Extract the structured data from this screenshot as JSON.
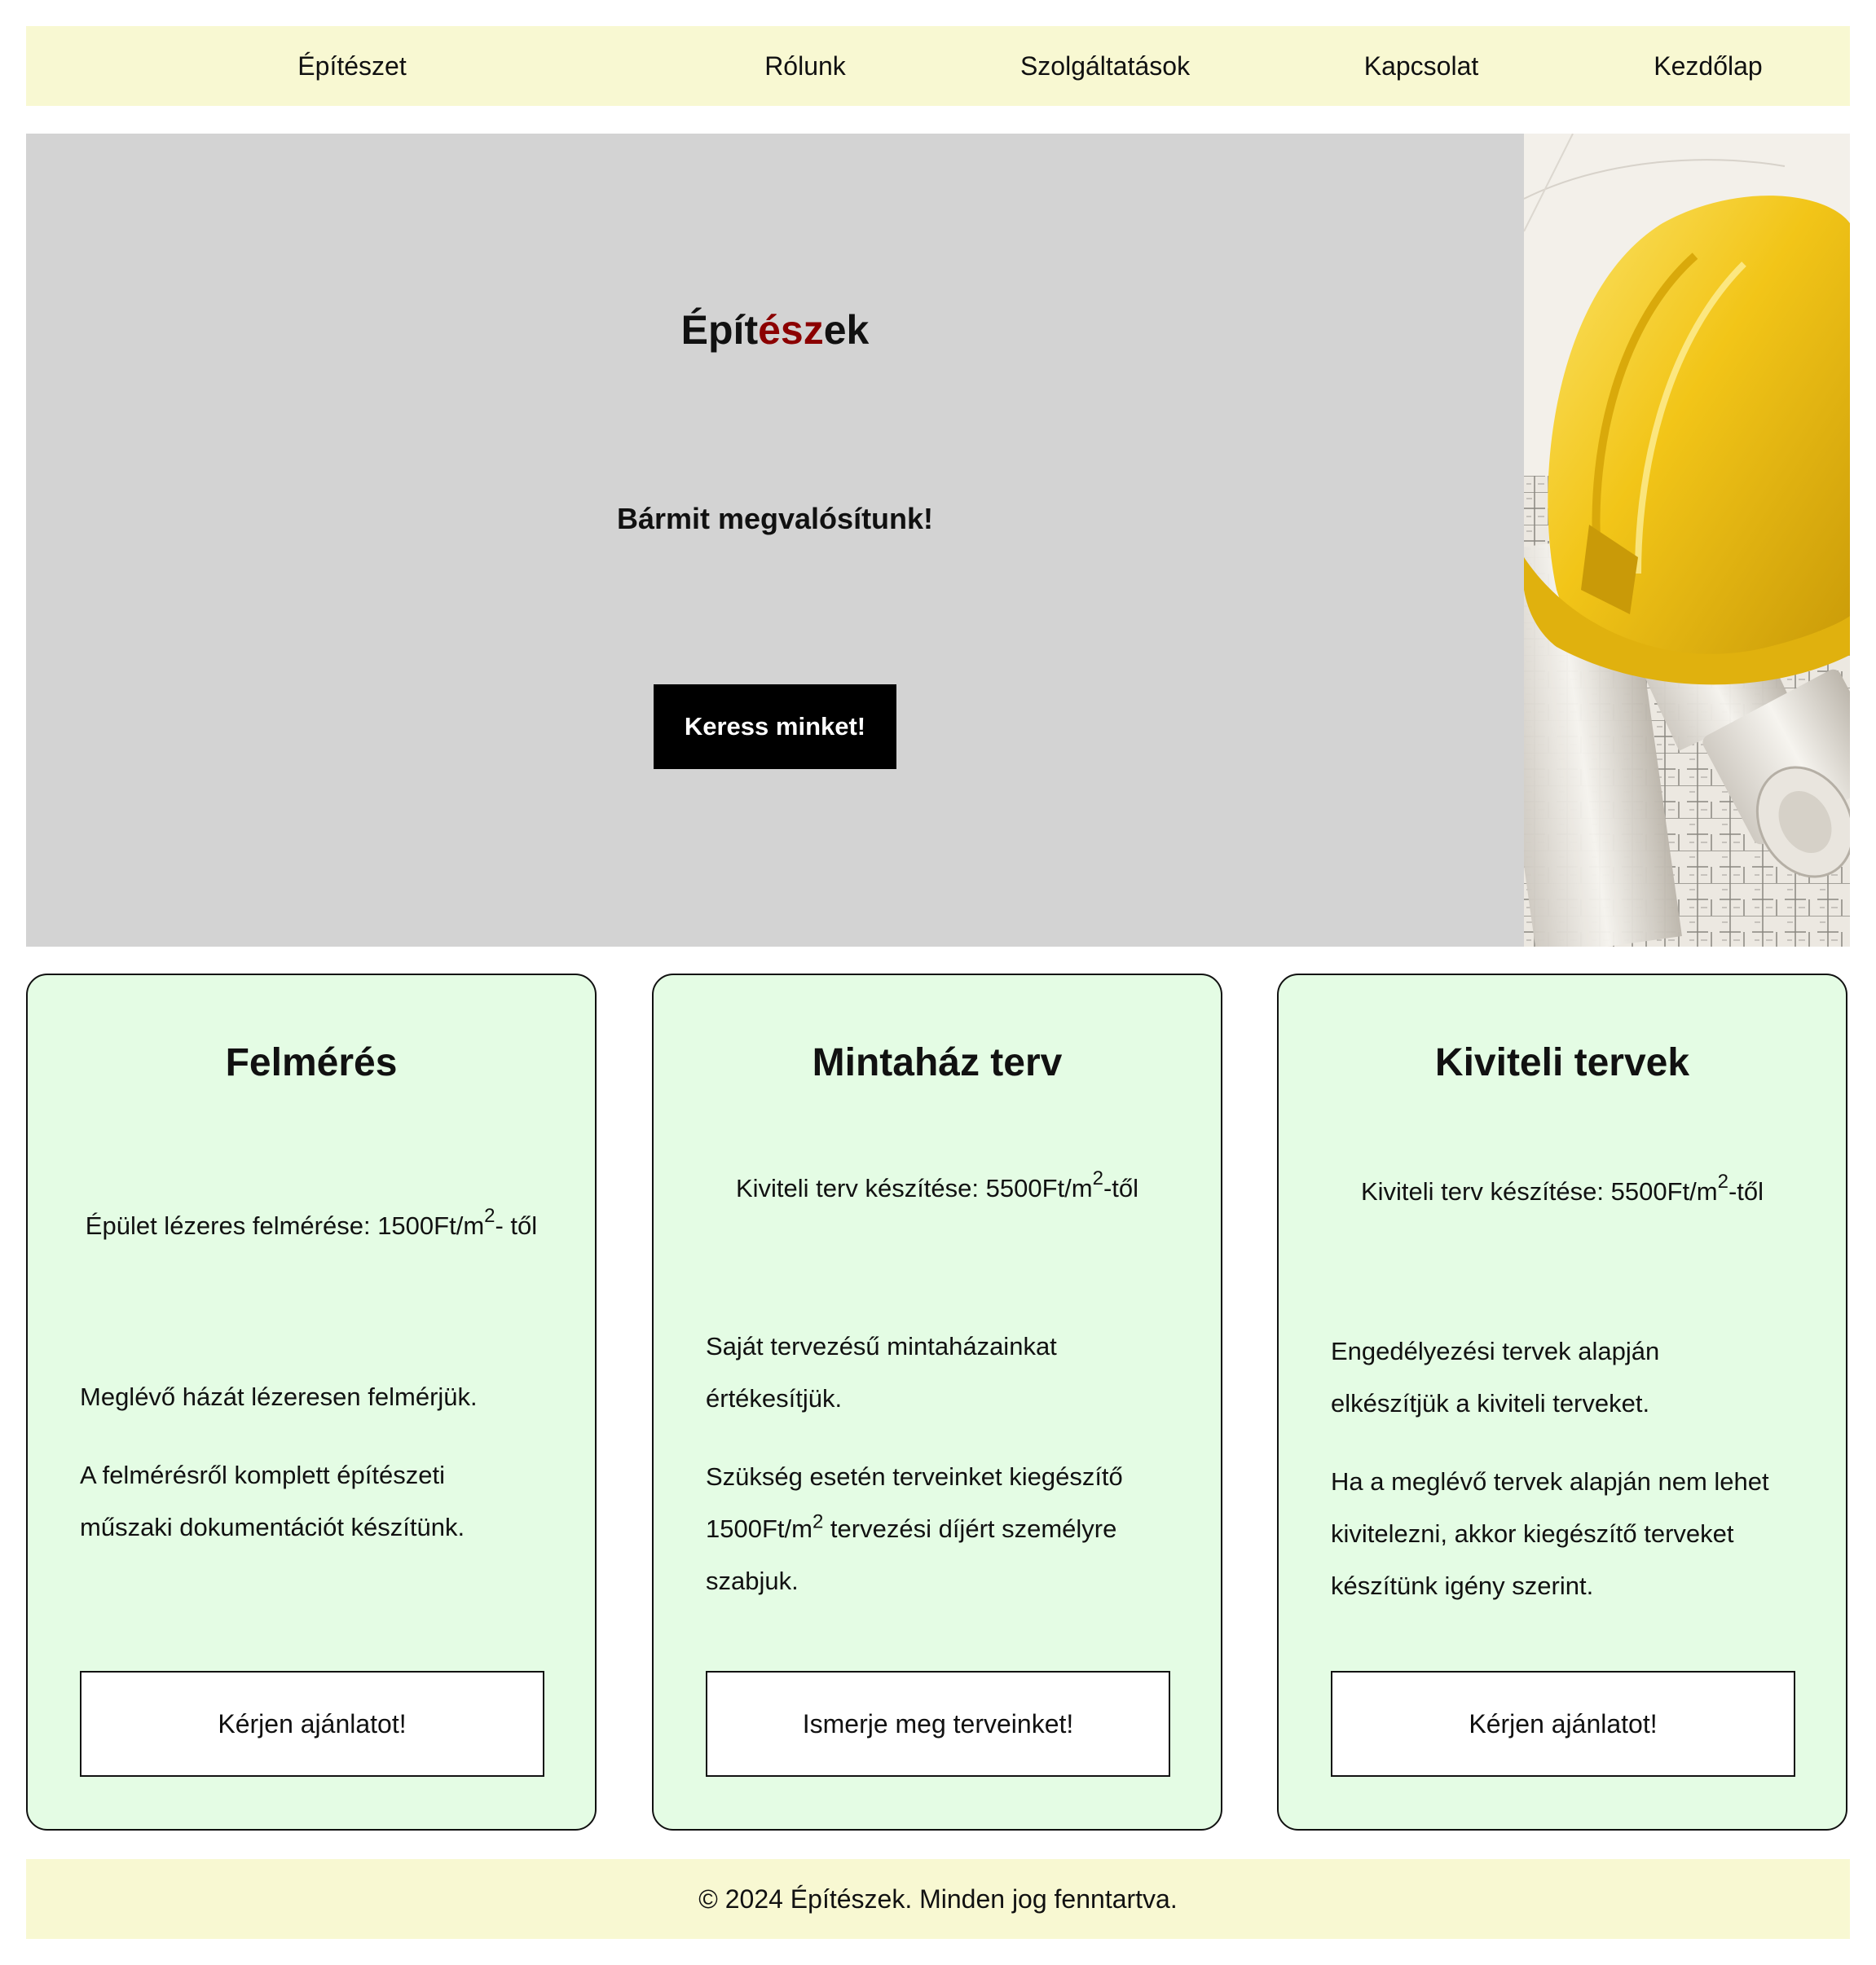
{
  "nav": {
    "brand": "Építészet",
    "items": [
      "Rólunk",
      "Szolgáltatások",
      "Kapcsolat",
      "Kezdőlap"
    ]
  },
  "hero": {
    "title_part1": "Épít",
    "title_accent": "ész",
    "title_part2": "ek",
    "subtitle": "Bármit megvalósítunk!",
    "cta": "Keress minket!",
    "image_icon": "hard-hat-on-blueprints-image",
    "accent_color": "#8b0000"
  },
  "cards": [
    {
      "title": "Felmérés",
      "price_text": "Épület lézeres felmérése: 1500Ft/m",
      "price_sup": "2",
      "price_suffix": "- től",
      "paragraphs": [
        "Meglévő házát lézeresen felmérjük.",
        "A felmérésről komplett építészeti műszaki dokumentációt készítünk."
      ],
      "button": "Kérjen ajánlatot!"
    },
    {
      "title": "Mintaház terv",
      "price_text": "Kiviteli terv készítése: 5500Ft/m",
      "price_sup": "2",
      "price_suffix": "-től",
      "paragraphs": [
        "Saját tervezésű mintaházainkat értékesítjük."
      ],
      "para2_pre": "Szükség esetén terveinket kiegészítő 1500Ft/m",
      "para2_sup": "2",
      "para2_post": " tervezési díjért személyre szabjuk.",
      "button": "Ismerje meg terveinket!"
    },
    {
      "title": "Kiviteli tervek",
      "price_text": "Kiviteli terv készítése: 5500Ft/m",
      "price_sup": "2",
      "price_suffix": "-től",
      "paragraphs": [
        "Engedélyezési tervek alapján elkészítjük a kiviteli terveket.",
        "Ha a meglévő tervek alapján nem lehet kivitelezni, akkor kiegészítő terveket készítünk igény szerint."
      ],
      "button": "Kérjen ajánlatot!"
    }
  ],
  "footer": {
    "text": "© 2024 Építészek. Minden jog fenntartva."
  },
  "colors": {
    "nav_bg": "#f8f8d2",
    "hero_bg": "#d3d3d3",
    "card_bg": "#e4fce4",
    "cta_bg": "#000000",
    "helmet": "#f2c518"
  }
}
